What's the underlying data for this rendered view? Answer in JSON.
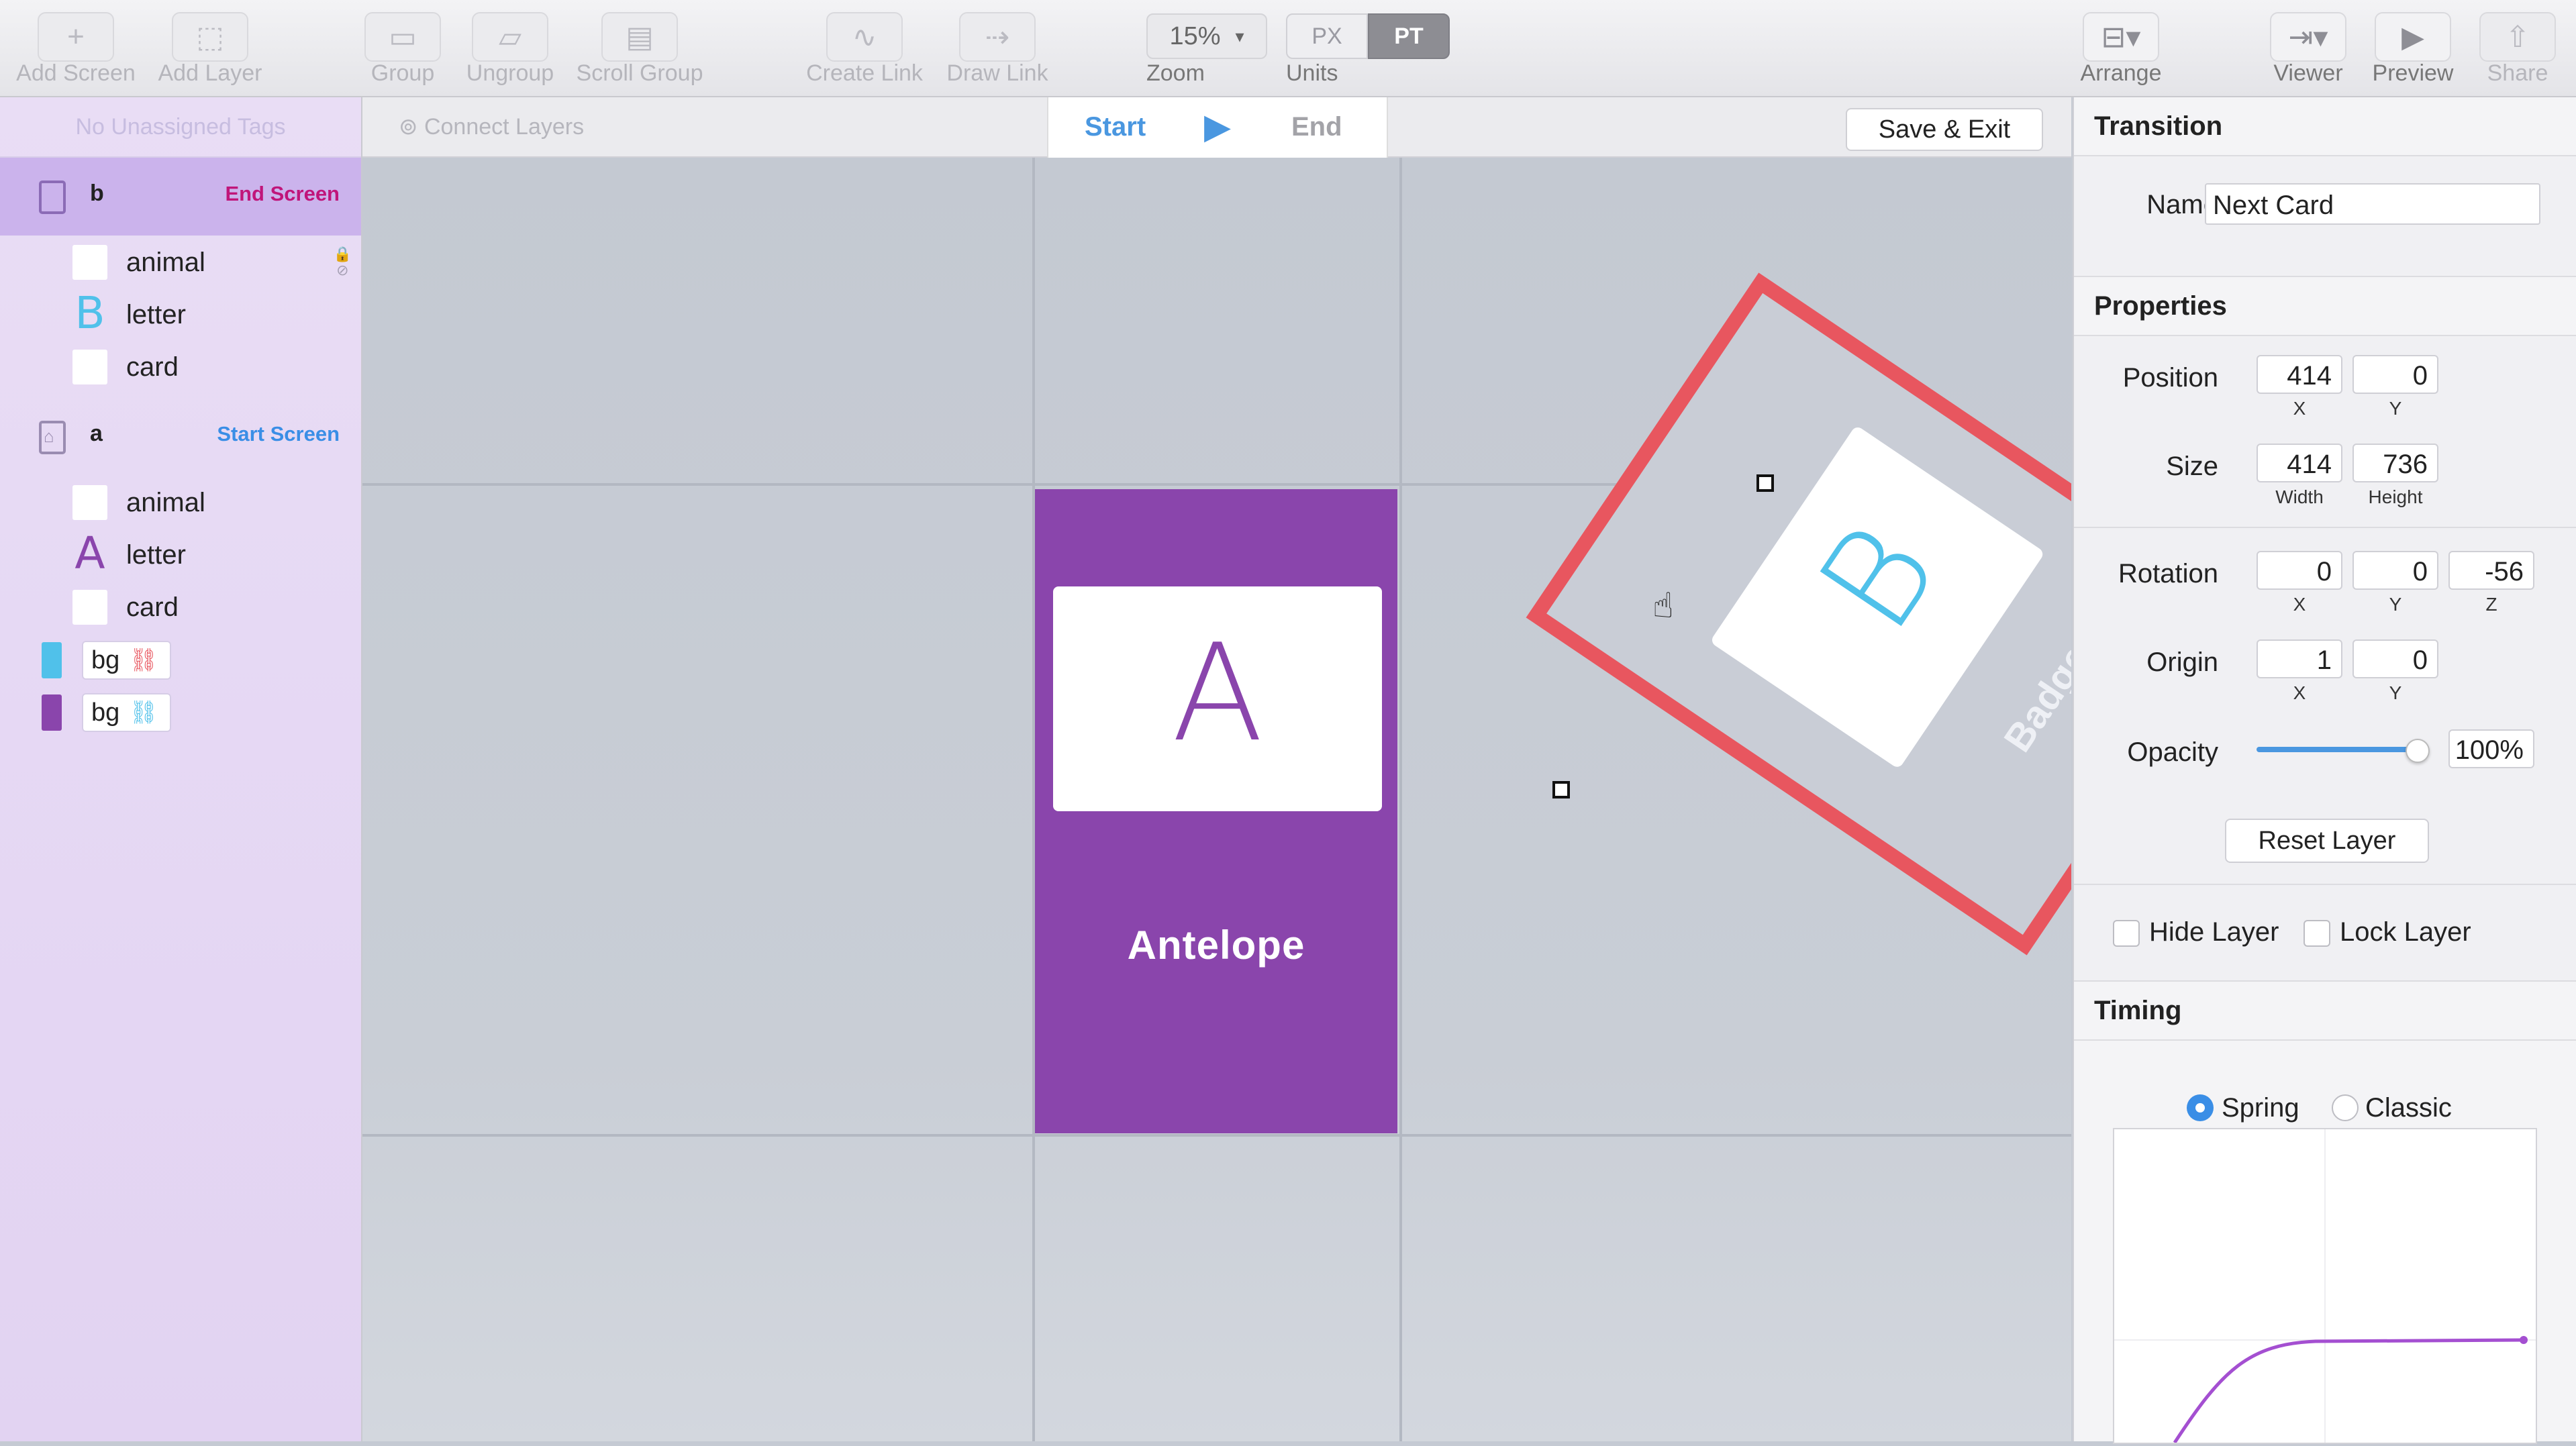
{
  "toolbar": {
    "add_screen": "Add Screen",
    "add_layer": "Add Layer",
    "group": "Group",
    "ungroup": "Ungroup",
    "scroll_group": "Scroll Group",
    "create_link": "Create Link",
    "draw_link": "Draw Link",
    "zoom_value": "15%",
    "zoom_label": "Zoom",
    "unit_px": "PX",
    "unit_pt": "PT",
    "units_label": "Units",
    "arrange": "Arrange",
    "viewer": "Viewer",
    "preview": "Preview",
    "share": "Share"
  },
  "sidebar": {
    "tags_placeholder": "No Unassigned Tags",
    "screens": [
      {
        "name": "b",
        "tag": "End Screen",
        "tag_color": "#c0157a",
        "layers": [
          {
            "name": "animal",
            "glyph": ""
          },
          {
            "name": "letter",
            "glyph": "B",
            "glyph_color": "#50c1ea"
          },
          {
            "name": "card",
            "glyph": ""
          }
        ]
      },
      {
        "name": "a",
        "tag": "Start Screen",
        "tag_color": "#3a8ee6",
        "layers": [
          {
            "name": "animal",
            "glyph": ""
          },
          {
            "name": "letter",
            "glyph": "A",
            "glyph_color": "#8a45ac"
          },
          {
            "name": "card",
            "glyph": ""
          }
        ]
      }
    ],
    "backgrounds": [
      {
        "name": "bg",
        "swatch": "#50c1ea",
        "link_color": "#e8565f"
      },
      {
        "name": "bg",
        "swatch": "#8a45ac",
        "link_color": "#50c1ea"
      }
    ]
  },
  "subbar": {
    "connect_layers": "Connect Layers",
    "start": "Start",
    "end": "End",
    "save_exit": "Save & Exit"
  },
  "canvas": {
    "card_a_letter": "A",
    "card_a_name": "Antelope",
    "card_a_color": "#8a45ac",
    "card_b_letter": "B",
    "card_b_badge": "Badge",
    "selection_color": "#e8565f"
  },
  "inspector": {
    "transition_title": "Transition",
    "name_label": "Name",
    "name_value": "Next Card",
    "properties_title": "Properties",
    "position_label": "Position",
    "position": {
      "x": "414",
      "y": "0",
      "x_label": "X",
      "y_label": "Y"
    },
    "size_label": "Size",
    "size": {
      "w": "414",
      "h": "736",
      "w_label": "Width",
      "h_label": "Height"
    },
    "rotation_label": "Rotation",
    "rotation": {
      "x": "0",
      "y": "0",
      "z": "-56",
      "x_label": "X",
      "y_label": "Y",
      "z_label": "Z"
    },
    "origin_label": "Origin",
    "origin": {
      "x": "1",
      "y": "0",
      "x_label": "X",
      "y_label": "Y"
    },
    "opacity_label": "Opacity",
    "opacity_value": "100%",
    "opacity_fraction": 1.0,
    "reset_layer": "Reset Layer",
    "hide_layer": "Hide Layer",
    "lock_layer": "Lock Layer",
    "timing_title": "Timing",
    "spring": "Spring",
    "classic": "Classic",
    "timing_mode": "Spring"
  }
}
